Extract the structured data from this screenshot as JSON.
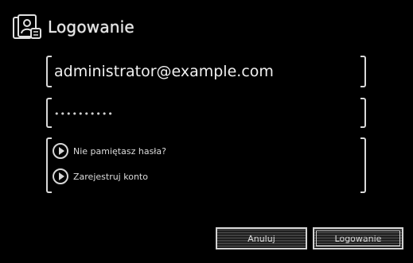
{
  "header": {
    "title": "Logowanie",
    "icon": "contact-card-icon"
  },
  "form": {
    "email_value": "administrator@example.com",
    "password_masked": "••••••••••"
  },
  "options": [
    {
      "label": "Nie pamiętasz hasła?",
      "icon": "play-circle-icon"
    },
    {
      "label": "Zarejestruj konto",
      "icon": "play-circle-icon"
    }
  ],
  "buttons": {
    "cancel_label": "Anuluj",
    "login_label": "Logowanie"
  }
}
